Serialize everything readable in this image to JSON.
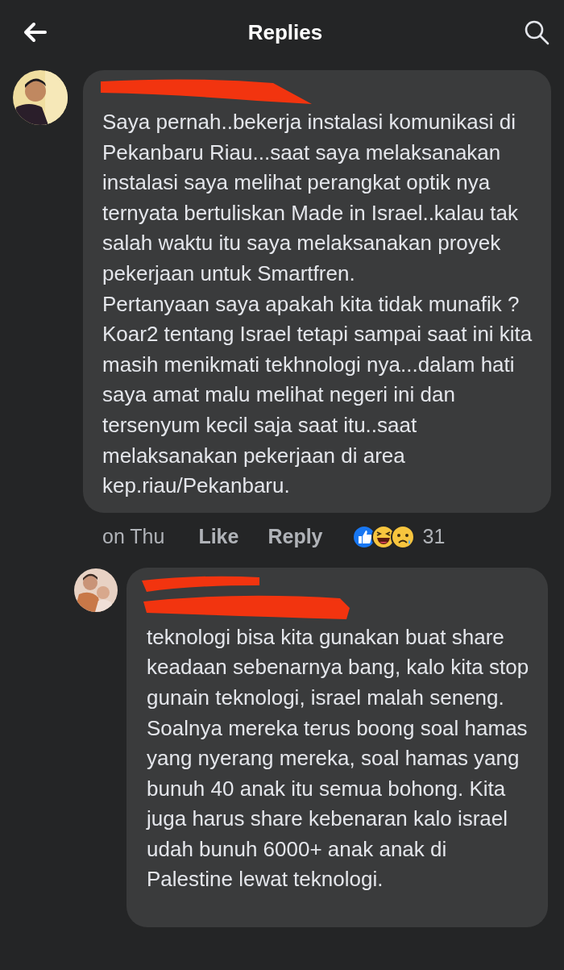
{
  "header": {
    "title": "Replies"
  },
  "comment": {
    "text": "Saya pernah..bekerja instalasi komunikasi di Pekanbaru Riau...saat saya melaksanakan instalasi saya melihat perangkat optik nya ternyata bertuliskan Made in Israel..kalau tak salah waktu itu saya melaksanakan proyek pekerjaan untuk Smartfren.\nPertanyaan saya apakah kita tidak munafik ? Koar2 tentang Israel tetapi sampai saat ini kita masih menikmati tekhnologi nya...dalam hati saya amat malu melihat negeri ini dan tersenyum kecil saja saat itu..saat melaksanakan pekerjaan di area kep.riau/Pekanbaru.",
    "time": "on Thu",
    "like": "Like",
    "reply": "Reply",
    "reaction_count": "31"
  },
  "reply": {
    "text": "teknologi bisa kita gunakan buat share keadaan sebenarnya bang, kalo kita stop gunain teknologi, israel malah seneng. Soalnya mereka terus boong soal hamas yang nyerang mereka, soal hamas yang bunuh 40 anak itu semua bohong. Kita juga harus share kebenaran kalo israel udah bunuh 6000+ anak anak di Palestine lewat teknologi."
  }
}
